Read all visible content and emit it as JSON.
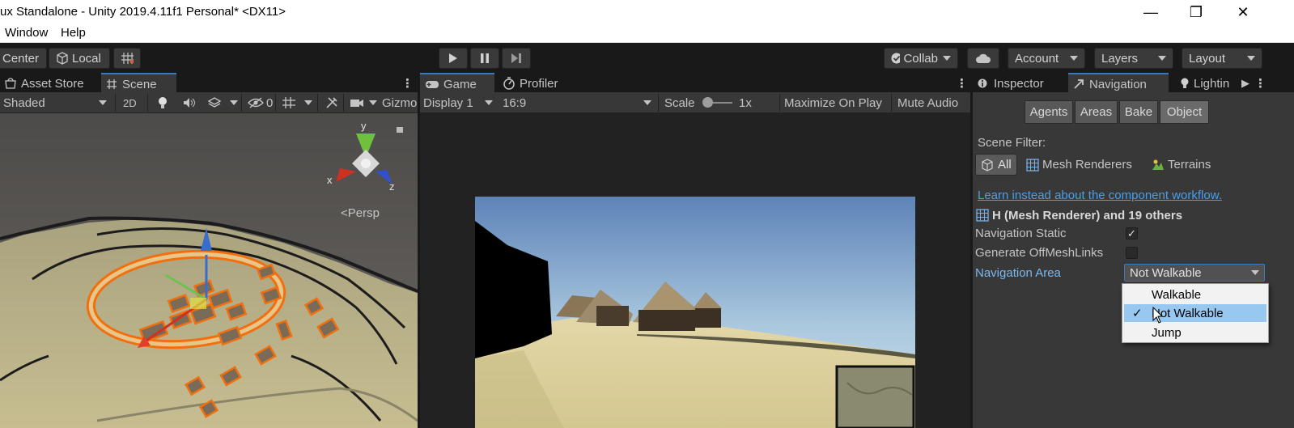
{
  "window": {
    "title": "ux Standalone - Unity 2019.4.11f1 Personal* <DX11>",
    "minimize_glyph": "—",
    "maximize_glyph": "❐",
    "close_glyph": "✕"
  },
  "menu": {
    "items": [
      "Window",
      "Help"
    ]
  },
  "toolbar": {
    "pivot_center": "Center",
    "pivot_local": "Local",
    "collab": "Collab",
    "account": "Account",
    "layers": "Layers",
    "layout": "Layout"
  },
  "scene_panel": {
    "tabs": [
      "Asset Store",
      "Scene"
    ],
    "shading": "Shaded",
    "mode_2d": "2D",
    "hidden_count": "0",
    "gizmos": "Gizmo",
    "persp": "<Persp",
    "axis_x": "x",
    "axis_y": "y",
    "axis_z": "z"
  },
  "game_panel": {
    "tabs": [
      "Game",
      "Profiler"
    ],
    "display": "Display 1",
    "aspect": "16:9",
    "scale_label": "Scale",
    "scale_value": "1x",
    "maximize_on_play": "Maximize On Play",
    "mute_audio": "Mute Audio"
  },
  "inspector_panel": {
    "tabs": [
      "Inspector",
      "Navigation",
      "Lightin"
    ],
    "nav_tabs": [
      "Agents",
      "Areas",
      "Bake",
      "Object"
    ],
    "scene_filter_label": "Scene Filter:",
    "filters": [
      "All",
      "Mesh Renderers",
      "Terrains"
    ],
    "link": "Learn instead about the component workflow.",
    "selection": "H (Mesh Renderer) and 19 others",
    "nav_static_label": "Navigation Static",
    "nav_static_checked": true,
    "check_glyph": "✓",
    "offmesh_label": "Generate OffMeshLinks",
    "offmesh_checked": false,
    "nav_area_label": "Navigation Area",
    "nav_area_value": "Not Walkable",
    "dropdown_options": [
      "Walkable",
      "Not Walkable",
      "Jump"
    ],
    "dropdown_selected": "Not Walkable"
  },
  "colors": {
    "accent": "#3a79bb",
    "link": "#4c9ee8",
    "dropdown_highlight": "#98c8f0"
  }
}
